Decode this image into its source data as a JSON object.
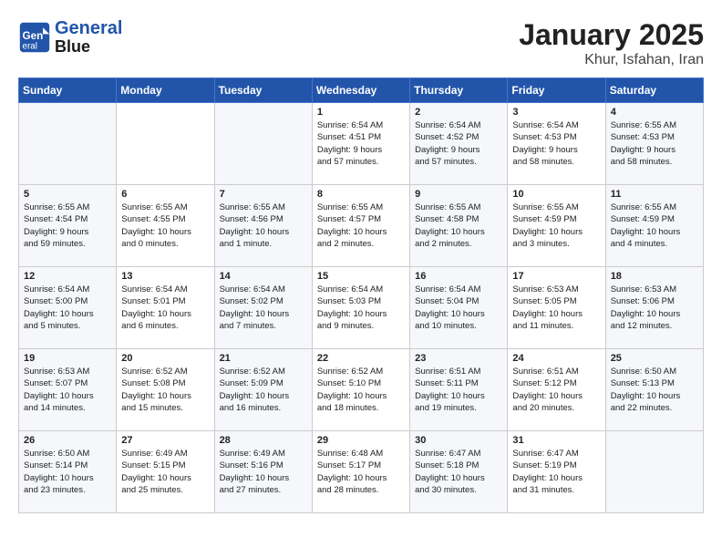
{
  "header": {
    "logo_line1": "General",
    "logo_line2": "Blue",
    "month_title": "January 2025",
    "subtitle": "Khur, Isfahan, Iran"
  },
  "weekdays": [
    "Sunday",
    "Monday",
    "Tuesday",
    "Wednesday",
    "Thursday",
    "Friday",
    "Saturday"
  ],
  "weeks": [
    [
      {
        "day": "",
        "info": ""
      },
      {
        "day": "",
        "info": ""
      },
      {
        "day": "",
        "info": ""
      },
      {
        "day": "1",
        "info": "Sunrise: 6:54 AM\nSunset: 4:51 PM\nDaylight: 9 hours\nand 57 minutes."
      },
      {
        "day": "2",
        "info": "Sunrise: 6:54 AM\nSunset: 4:52 PM\nDaylight: 9 hours\nand 57 minutes."
      },
      {
        "day": "3",
        "info": "Sunrise: 6:54 AM\nSunset: 4:53 PM\nDaylight: 9 hours\nand 58 minutes."
      },
      {
        "day": "4",
        "info": "Sunrise: 6:55 AM\nSunset: 4:53 PM\nDaylight: 9 hours\nand 58 minutes."
      }
    ],
    [
      {
        "day": "5",
        "info": "Sunrise: 6:55 AM\nSunset: 4:54 PM\nDaylight: 9 hours\nand 59 minutes."
      },
      {
        "day": "6",
        "info": "Sunrise: 6:55 AM\nSunset: 4:55 PM\nDaylight: 10 hours\nand 0 minutes."
      },
      {
        "day": "7",
        "info": "Sunrise: 6:55 AM\nSunset: 4:56 PM\nDaylight: 10 hours\nand 1 minute."
      },
      {
        "day": "8",
        "info": "Sunrise: 6:55 AM\nSunset: 4:57 PM\nDaylight: 10 hours\nand 2 minutes."
      },
      {
        "day": "9",
        "info": "Sunrise: 6:55 AM\nSunset: 4:58 PM\nDaylight: 10 hours\nand 2 minutes."
      },
      {
        "day": "10",
        "info": "Sunrise: 6:55 AM\nSunset: 4:59 PM\nDaylight: 10 hours\nand 3 minutes."
      },
      {
        "day": "11",
        "info": "Sunrise: 6:55 AM\nSunset: 4:59 PM\nDaylight: 10 hours\nand 4 minutes."
      }
    ],
    [
      {
        "day": "12",
        "info": "Sunrise: 6:54 AM\nSunset: 5:00 PM\nDaylight: 10 hours\nand 5 minutes."
      },
      {
        "day": "13",
        "info": "Sunrise: 6:54 AM\nSunset: 5:01 PM\nDaylight: 10 hours\nand 6 minutes."
      },
      {
        "day": "14",
        "info": "Sunrise: 6:54 AM\nSunset: 5:02 PM\nDaylight: 10 hours\nand 7 minutes."
      },
      {
        "day": "15",
        "info": "Sunrise: 6:54 AM\nSunset: 5:03 PM\nDaylight: 10 hours\nand 9 minutes."
      },
      {
        "day": "16",
        "info": "Sunrise: 6:54 AM\nSunset: 5:04 PM\nDaylight: 10 hours\nand 10 minutes."
      },
      {
        "day": "17",
        "info": "Sunrise: 6:53 AM\nSunset: 5:05 PM\nDaylight: 10 hours\nand 11 minutes."
      },
      {
        "day": "18",
        "info": "Sunrise: 6:53 AM\nSunset: 5:06 PM\nDaylight: 10 hours\nand 12 minutes."
      }
    ],
    [
      {
        "day": "19",
        "info": "Sunrise: 6:53 AM\nSunset: 5:07 PM\nDaylight: 10 hours\nand 14 minutes."
      },
      {
        "day": "20",
        "info": "Sunrise: 6:52 AM\nSunset: 5:08 PM\nDaylight: 10 hours\nand 15 minutes."
      },
      {
        "day": "21",
        "info": "Sunrise: 6:52 AM\nSunset: 5:09 PM\nDaylight: 10 hours\nand 16 minutes."
      },
      {
        "day": "22",
        "info": "Sunrise: 6:52 AM\nSunset: 5:10 PM\nDaylight: 10 hours\nand 18 minutes."
      },
      {
        "day": "23",
        "info": "Sunrise: 6:51 AM\nSunset: 5:11 PM\nDaylight: 10 hours\nand 19 minutes."
      },
      {
        "day": "24",
        "info": "Sunrise: 6:51 AM\nSunset: 5:12 PM\nDaylight: 10 hours\nand 20 minutes."
      },
      {
        "day": "25",
        "info": "Sunrise: 6:50 AM\nSunset: 5:13 PM\nDaylight: 10 hours\nand 22 minutes."
      }
    ],
    [
      {
        "day": "26",
        "info": "Sunrise: 6:50 AM\nSunset: 5:14 PM\nDaylight: 10 hours\nand 23 minutes."
      },
      {
        "day": "27",
        "info": "Sunrise: 6:49 AM\nSunset: 5:15 PM\nDaylight: 10 hours\nand 25 minutes."
      },
      {
        "day": "28",
        "info": "Sunrise: 6:49 AM\nSunset: 5:16 PM\nDaylight: 10 hours\nand 27 minutes."
      },
      {
        "day": "29",
        "info": "Sunrise: 6:48 AM\nSunset: 5:17 PM\nDaylight: 10 hours\nand 28 minutes."
      },
      {
        "day": "30",
        "info": "Sunrise: 6:47 AM\nSunset: 5:18 PM\nDaylight: 10 hours\nand 30 minutes."
      },
      {
        "day": "31",
        "info": "Sunrise: 6:47 AM\nSunset: 5:19 PM\nDaylight: 10 hours\nand 31 minutes."
      },
      {
        "day": "",
        "info": ""
      }
    ]
  ]
}
